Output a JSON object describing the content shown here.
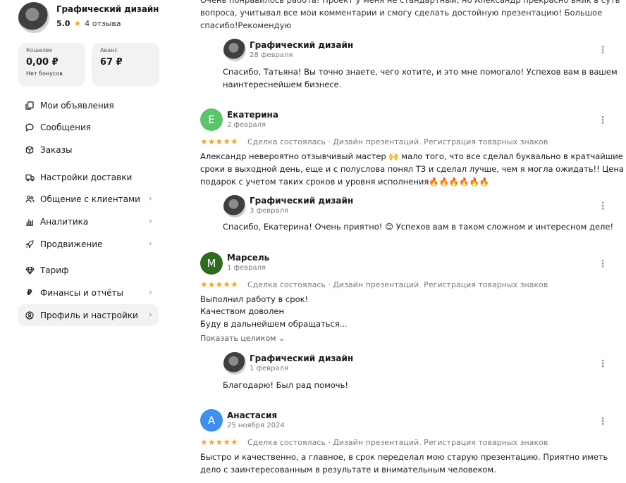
{
  "sidebar": {
    "profile": {
      "name": "Графический дизайн",
      "rating": "5.0",
      "reviews": "4 отзыва"
    },
    "wallet": {
      "label": "Кошелёк",
      "value": "0,00 ₽",
      "sub": "Нет бонусов"
    },
    "advance": {
      "label": "Аванс",
      "value": "67 ₽"
    },
    "menu": [
      {
        "label": "Мои объявления",
        "icon": "copy-icon"
      },
      {
        "label": "Сообщения",
        "icon": "chat-icon"
      },
      {
        "label": "Заказы",
        "icon": "box-icon"
      },
      {
        "label": "Настройки доставки",
        "icon": "truck-icon"
      },
      {
        "label": "Общение с клиентами",
        "icon": "people-icon"
      },
      {
        "label": "Аналитика",
        "icon": "chart-icon"
      },
      {
        "label": "Продвижение",
        "icon": "rocket-icon"
      },
      {
        "label": "Тариф",
        "icon": "diamond-icon"
      },
      {
        "label": "Финансы и отчёты",
        "icon": "ruble-icon"
      },
      {
        "label": "Профиль и настройки",
        "icon": "user-circle-icon"
      }
    ]
  },
  "reviews": {
    "top": {
      "line1": "Очень понравилось работа! Проект у меня не стандартный, но Александр прекрасно вник в суть",
      "line2": "вопроса, учитывал все мои комментарии и смогу сделать достойную презентацию! Большое",
      "line3": "спасибо!Рекомендую",
      "reply": {
        "author": "Графический дизайн",
        "date": "28 февраля",
        "line1": "Спасибо, Татьяна! Вы точно знаете, чего хотите, и это мне помогало! Успехов вам в вашем",
        "line2": "наинтереснейшем бизнесе."
      }
    },
    "items": [
      {
        "initial": "Е",
        "color": "#5cc46b",
        "author": "Екатерина",
        "date": "2 февраля",
        "stars": "★★★★★",
        "meta": "Сделка состоялась · Дизайн презентаций. Регистрация товарных знаков",
        "line1": "Александр невероятно отзывчивый мастер 🙌 мало того, что все сделал буквально в кратчайшие",
        "line2": "сроки в выходной день, еще и с полуслова понял ТЗ и сделал лучше, чем я могла ожидать!! Цена -",
        "line3": "подарок с учетом таких сроков и уровня исполнения🔥🔥🔥🔥🔥🔥",
        "reply": {
          "author": "Графический дизайн",
          "date": "3 февраля",
          "line1": "Спасибо, Екатерина! Очень приятно! 😊 Успехов вам в таком сложном и интересном деле!"
        }
      },
      {
        "initial": "М",
        "color": "#2f6a1f",
        "author": "Марсель",
        "date": "1 февраля",
        "stars": "★★★★★",
        "meta": "Сделка состоялась · Дизайн презентаций. Регистрация товарных знаков",
        "line1": "Выполнил работу в срок!",
        "line2": "Качеством доволен",
        "line3": "Буду в дальнейшем обращаться...",
        "showmore": "Показать целиком ⌄",
        "reply": {
          "author": "Графический дизайн",
          "date": "1 февраля",
          "line1": "Благодарю! Был рад помочь!"
        }
      },
      {
        "initial": "А",
        "color": "#3d8ff0",
        "author": "Анастасия",
        "date": "25 ноября 2024",
        "stars": "★★★★★",
        "meta": "Сделка состоялась · Дизайн презентаций. Регистрация товарных знаков",
        "line1": "Быстро и качественно, а главное, в срок переделал мою старую презентацию. Приятно иметь",
        "line2": "дело с заинтересованным в результате и внимательным человеком."
      }
    ]
  }
}
